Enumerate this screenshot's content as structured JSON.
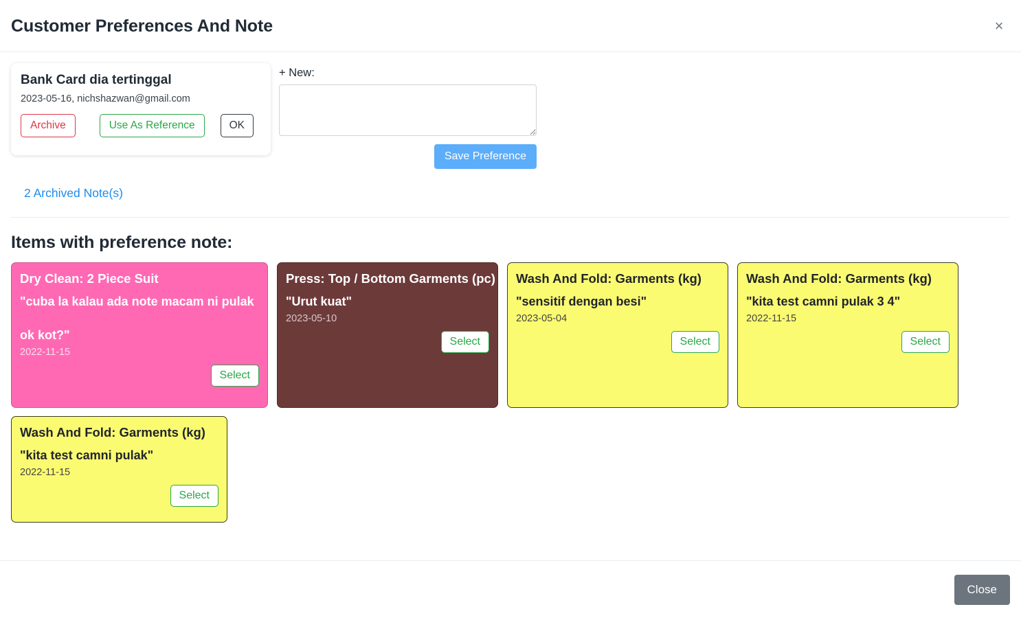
{
  "header": {
    "title": "Customer Preferences And Note",
    "close_icon": "close-icon",
    "close_glyph": "×"
  },
  "note_card": {
    "title": "Bank Card dia tertinggal",
    "meta": "2023-05-16, nichshazwan@gmail.com",
    "archive_label": "Archive",
    "use_as_reference_label": "Use As Reference",
    "ok_label": "OK"
  },
  "new_note": {
    "label": "+ New:",
    "textarea_value": "",
    "textarea_placeholder": "",
    "save_label": "Save Preference"
  },
  "archived": {
    "link_label": "2 Archived Note(s)"
  },
  "items_section": {
    "title": "Items with preference note:",
    "select_label": "Select",
    "cards": [
      {
        "item": "Dry Clean: 2 Piece Suit",
        "note": "\"cuba la kalau ada note macam ni pulak\n\nok kot?\"",
        "date": "2022-11-15",
        "theme": "pink",
        "select_label": "Select"
      },
      {
        "item": "Press: Top / Bottom Garments (pc)",
        "note": "\"Urut kuat\"",
        "date": "2023-05-10",
        "theme": "brown",
        "select_label": "Select"
      },
      {
        "item": "Wash And Fold: Garments (kg)",
        "note": "\"sensitif dengan besi\"",
        "date": "2023-05-04",
        "theme": "yellow",
        "select_label": "Select"
      },
      {
        "item": "Wash And Fold: Garments (kg)",
        "note": "\"kita test camni pulak 3 4\"",
        "date": "2022-11-15",
        "theme": "yellow",
        "select_label": "Select"
      },
      {
        "item": "Wash And Fold: Garments (kg)",
        "note": "\"kita test camni pulak\"",
        "date": "2022-11-15",
        "theme": "yellow",
        "select_label": "Select"
      }
    ]
  },
  "footer": {
    "close_label": "Close"
  },
  "colors": {
    "accent_blue": "#5cadfa",
    "link_blue": "#1d8ced",
    "danger_red": "#dc3545",
    "success_green": "#28a745",
    "secondary_gray": "#6c757d",
    "card_pink": "#ff69b4",
    "card_brown": "#6d3a3a",
    "card_yellow": "#fbfb72"
  }
}
